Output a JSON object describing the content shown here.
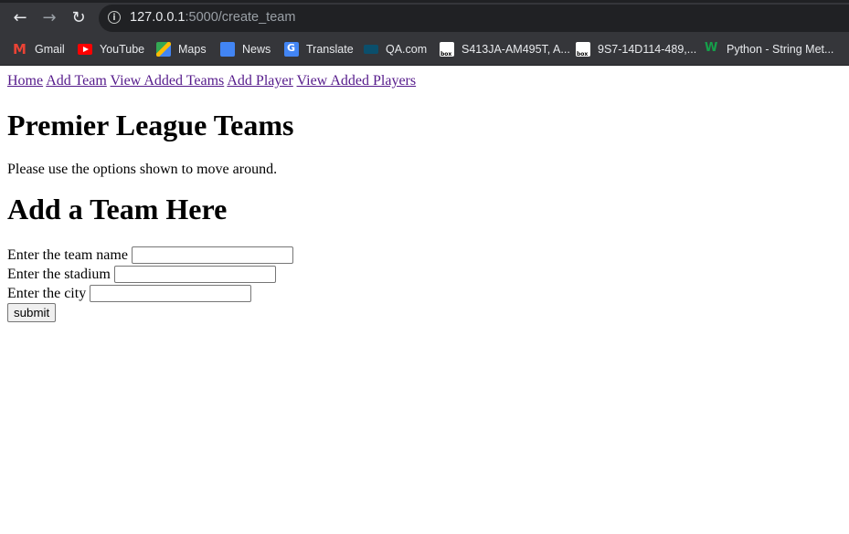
{
  "browser": {
    "url_host": "127.0.0.1",
    "url_rest": ":5000/create_team",
    "bookmarks": [
      {
        "label": "Gmail",
        "icon": "gmail-icon"
      },
      {
        "label": "YouTube",
        "icon": "youtube-icon"
      },
      {
        "label": "Maps",
        "icon": "maps-icon"
      },
      {
        "label": "News",
        "icon": "news-icon"
      },
      {
        "label": "Translate",
        "icon": "translate-icon"
      },
      {
        "label": "QA.com",
        "icon": "qa-icon"
      },
      {
        "label": "S413JA-AM495T, A...",
        "icon": "box-icon"
      },
      {
        "label": "9S7-14D114-489,...",
        "icon": "box-icon"
      },
      {
        "label": "Python - String Met...",
        "icon": "w3schools-icon"
      }
    ]
  },
  "nav": {
    "links": [
      "Home",
      "Add Team",
      "View Added Teams",
      "Add Player",
      "View Added Players"
    ]
  },
  "page": {
    "title": "Premier League Teams",
    "intro": "Please use the options shown to move around.",
    "form_title": "Add a Team Here"
  },
  "form": {
    "team_name_label": "Enter the team name",
    "team_name_value": "",
    "stadium_label": "Enter the stadium",
    "stadium_value": "",
    "city_label": "Enter the city",
    "city_value": "",
    "submit_label": "submit"
  }
}
